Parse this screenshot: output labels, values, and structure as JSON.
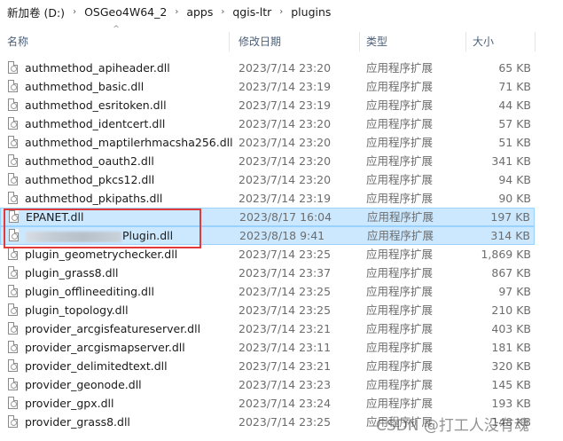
{
  "breadcrumb": [
    {
      "label": "新加卷 (D:)"
    },
    {
      "label": "OSGeo4W64_2"
    },
    {
      "label": "apps"
    },
    {
      "label": "qgis-ltr"
    },
    {
      "label": "plugins"
    }
  ],
  "breadcrumb_separator": "›",
  "columns": {
    "name": "名称",
    "date": "修改日期",
    "type": "类型",
    "size": "大小"
  },
  "sort_indicator": "^",
  "files": [
    {
      "name": "authmethod_apiheader.dll",
      "date": "2023/7/14 23:20",
      "type": "应用程序扩展",
      "size": "65 KB"
    },
    {
      "name": "authmethod_basic.dll",
      "date": "2023/7/14 23:19",
      "type": "应用程序扩展",
      "size": "71 KB"
    },
    {
      "name": "authmethod_esritoken.dll",
      "date": "2023/7/14 23:19",
      "type": "应用程序扩展",
      "size": "44 KB"
    },
    {
      "name": "authmethod_identcert.dll",
      "date": "2023/7/14 23:20",
      "type": "应用程序扩展",
      "size": "57 KB"
    },
    {
      "name": "authmethod_maptilerhmacsha256.dll",
      "date": "2023/7/14 23:20",
      "type": "应用程序扩展",
      "size": "51 KB"
    },
    {
      "name": "authmethod_oauth2.dll",
      "date": "2023/7/14 23:20",
      "type": "应用程序扩展",
      "size": "341 KB"
    },
    {
      "name": "authmethod_pkcs12.dll",
      "date": "2023/7/14 23:20",
      "type": "应用程序扩展",
      "size": "94 KB"
    },
    {
      "name": "authmethod_pkipaths.dll",
      "date": "2023/7/14 23:19",
      "type": "应用程序扩展",
      "size": "90 KB"
    },
    {
      "name": "EPANET.dll",
      "date": "2023/8/17 16:04",
      "type": "应用程序扩展",
      "size": "197 KB",
      "selected": true
    },
    {
      "name": "Plugin.dll",
      "date": "2023/8/18 9:41",
      "type": "应用程序扩展",
      "size": "314 KB",
      "selected": true,
      "redacted_prefix": true
    },
    {
      "name": "plugin_geometrychecker.dll",
      "date": "2023/7/14 23:25",
      "type": "应用程序扩展",
      "size": "1,869 KB"
    },
    {
      "name": "plugin_grass8.dll",
      "date": "2023/7/14 23:37",
      "type": "应用程序扩展",
      "size": "867 KB"
    },
    {
      "name": "plugin_offlineediting.dll",
      "date": "2023/7/14 23:25",
      "type": "应用程序扩展",
      "size": "97 KB"
    },
    {
      "name": "plugin_topology.dll",
      "date": "2023/7/14 23:25",
      "type": "应用程序扩展",
      "size": "210 KB"
    },
    {
      "name": "provider_arcgisfeatureserver.dll",
      "date": "2023/7/14 23:21",
      "type": "应用程序扩展",
      "size": "403 KB"
    },
    {
      "name": "provider_arcgismapserver.dll",
      "date": "2023/7/14 23:11",
      "type": "应用程序扩展",
      "size": "181 KB"
    },
    {
      "name": "provider_delimitedtext.dll",
      "date": "2023/7/14 23:21",
      "type": "应用程序扩展",
      "size": "320 KB"
    },
    {
      "name": "provider_geonode.dll",
      "date": "2023/7/14 23:23",
      "type": "应用程序扩展",
      "size": "145 KB"
    },
    {
      "name": "provider_gpx.dll",
      "date": "2023/7/14 23:24",
      "type": "应用程序扩展",
      "size": "193 KB"
    },
    {
      "name": "provider_grass8.dll",
      "date": "2023/7/14 23:25",
      "type": "应用程序扩展",
      "size": "148 KB"
    }
  ],
  "watermark": "CSDN @打工人没有魂",
  "colors": {
    "selection_bg": "#cce8ff",
    "selection_border": "#99d1ff",
    "annotation_box": "#e03a3a",
    "header_text": "#4c607a"
  }
}
